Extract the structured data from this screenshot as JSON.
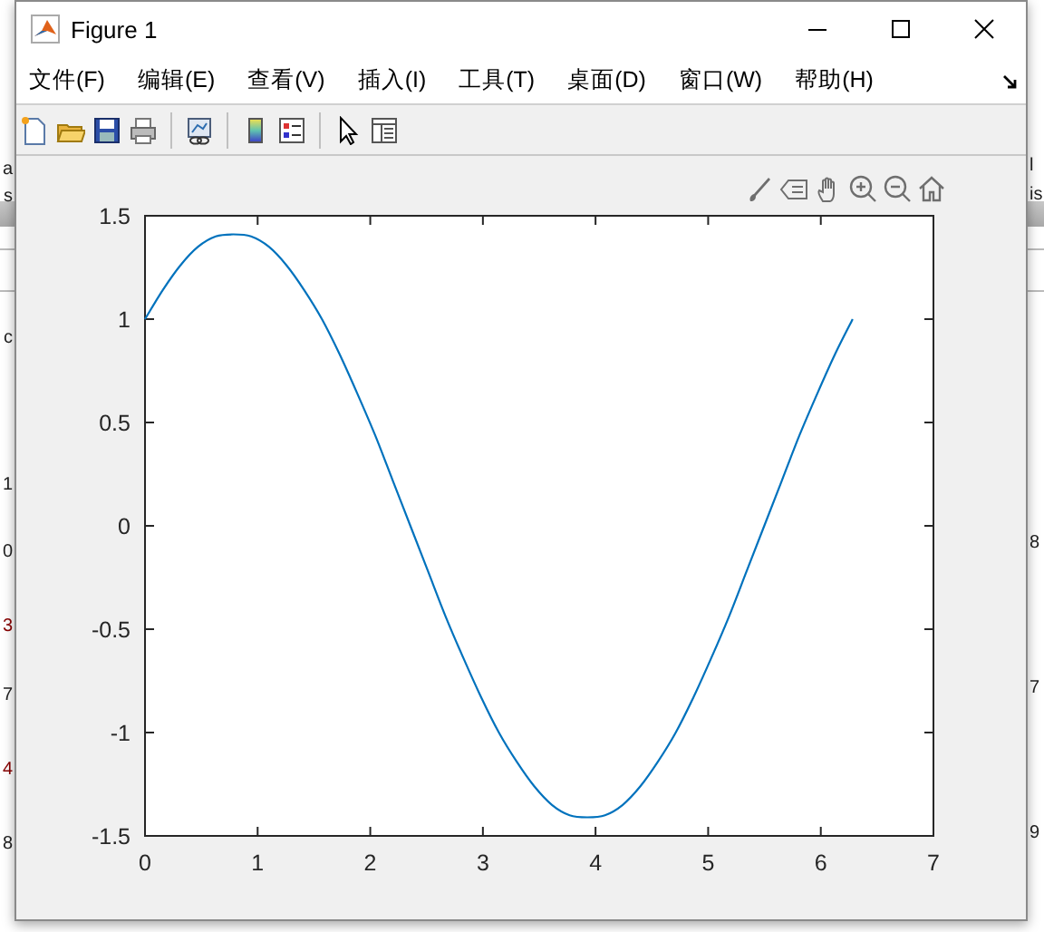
{
  "background_window": {
    "left_fragments": [
      {
        "text": "a"
      },
      {
        "text": "s"
      },
      {
        "text": "c"
      },
      {
        "text": "1"
      },
      {
        "text": "0"
      },
      {
        "text": "3"
      },
      {
        "text": "7"
      },
      {
        "text": "4"
      },
      {
        "text": "8"
      }
    ],
    "right_fragments": [
      {
        "text": "l"
      },
      {
        "text": "is"
      },
      {
        "text": "8"
      },
      {
        "text": "7"
      },
      {
        "text": "9"
      }
    ]
  },
  "window": {
    "title": "Figure 1"
  },
  "menu": [
    {
      "label": "文件(F)"
    },
    {
      "label": "编辑(E)"
    },
    {
      "label": "查看(V)"
    },
    {
      "label": "插入(I)"
    },
    {
      "label": "工具(T)"
    },
    {
      "label": "桌面(D)"
    },
    {
      "label": "窗口(W)"
    },
    {
      "label": "帮助(H)"
    }
  ],
  "figure": {
    "chart_data": {
      "type": "line",
      "x": [
        0,
        0.157,
        0.314,
        0.471,
        0.628,
        0.785,
        0.942,
        1.1,
        1.257,
        1.414,
        1.571,
        1.728,
        1.885,
        2.042,
        2.199,
        2.356,
        2.513,
        2.67,
        2.827,
        2.985,
        3.142,
        3.299,
        3.456,
        3.613,
        3.77,
        3.927,
        4.084,
        4.241,
        4.398,
        4.555,
        4.712,
        4.869,
        5.027,
        5.184,
        5.341,
        5.498,
        5.655,
        5.812,
        5.969,
        6.126,
        6.283
      ],
      "series": [
        {
          "color": "#0072bd",
          "values": [
            1,
            1.14,
            1.26,
            1.35,
            1.4,
            1.41,
            1.4,
            1.35,
            1.26,
            1.14,
            1,
            0.83,
            0.64,
            0.44,
            0.22,
            0,
            -0.22,
            -0.44,
            -0.64,
            -0.83,
            -1,
            -1.14,
            -1.26,
            -1.35,
            -1.4,
            -1.41,
            -1.4,
            -1.35,
            -1.26,
            -1.14,
            -1,
            -0.83,
            -0.64,
            -0.44,
            -0.22,
            0,
            0.22,
            0.44,
            0.64,
            0.83,
            1
          ]
        }
      ],
      "xlim": [
        0,
        7
      ],
      "ylim": [
        -1.5,
        1.5
      ],
      "xticks": [
        0,
        1,
        2,
        3,
        4,
        5,
        6,
        7
      ],
      "yticks": [
        1.5,
        1,
        0.5,
        0,
        -0.5,
        -1,
        -1.5
      ]
    }
  }
}
